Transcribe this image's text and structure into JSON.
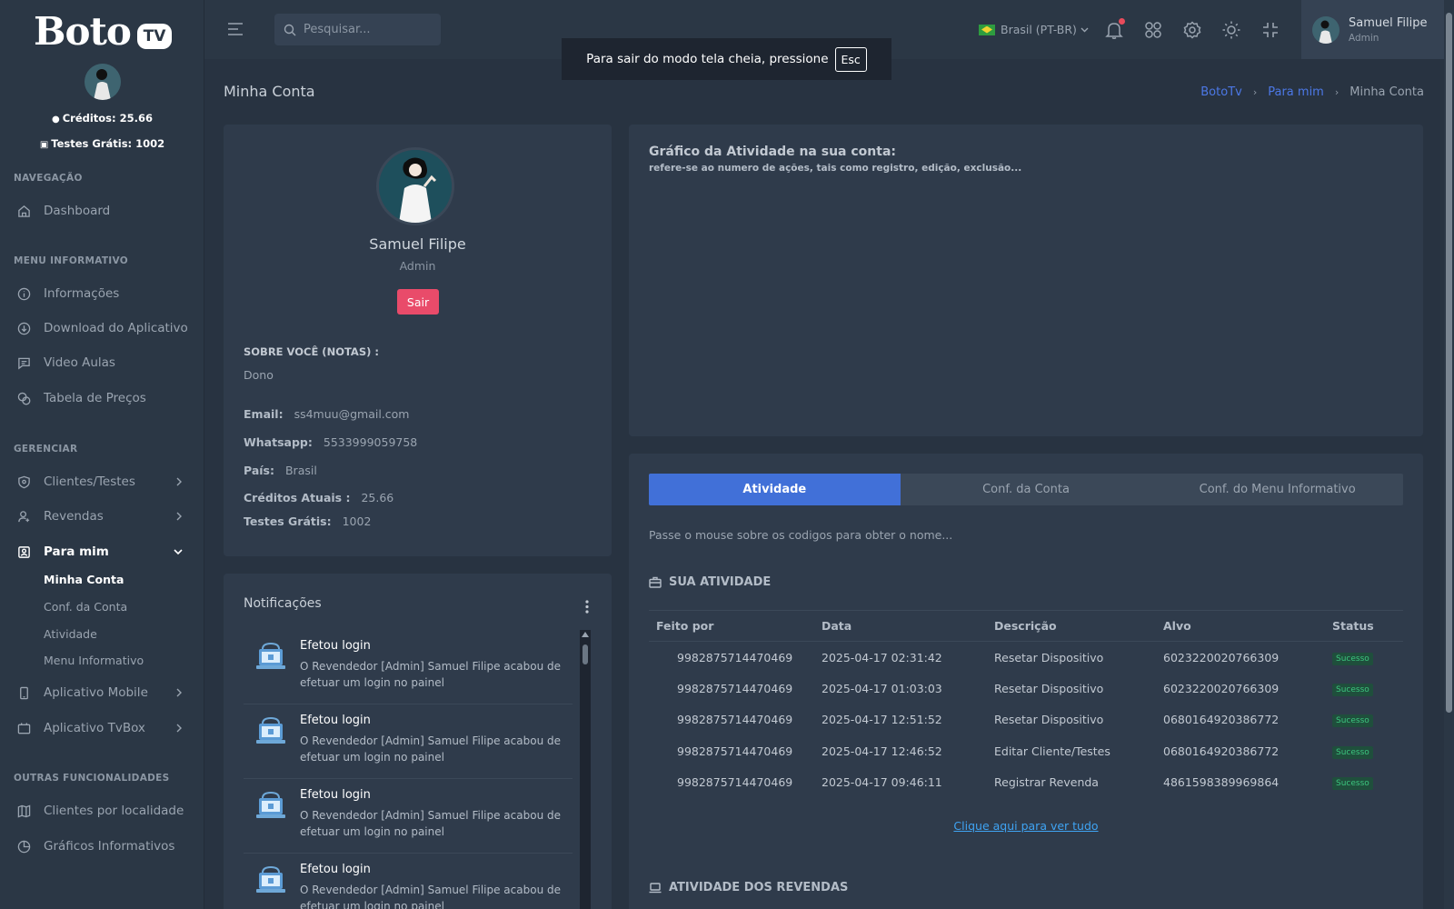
{
  "brand": {
    "name": "Boto",
    "badge": "TV"
  },
  "sidebar": {
    "credits": "Créditos: 25.66",
    "free_tests": "Testes Grátis: 1002",
    "headers": [
      "NAVEGAÇÃO",
      "MENU INFORMATIVO",
      "GERENCIAR",
      "OUTRAS FUNCIONALIDADES"
    ],
    "items": [
      {
        "label": "Dashboard",
        "icon": "home-icon"
      },
      {
        "label": "Informações",
        "icon": "info-icon"
      },
      {
        "label": "Download do Aplicativo",
        "icon": "download-icon"
      },
      {
        "label": "Video Aulas",
        "icon": "chat-icon"
      },
      {
        "label": "Tabela de Preços",
        "icon": "coins-icon"
      },
      {
        "label": "Clientes/Testes",
        "icon": "shield-icon"
      },
      {
        "label": "Revendas",
        "icon": "user-icon"
      },
      {
        "label": "Para mim",
        "icon": "user-square-icon"
      },
      {
        "label": "Aplicativo Mobile",
        "icon": "mobile-icon"
      },
      {
        "label": "Aplicativo TvBox",
        "icon": "tv-icon"
      },
      {
        "label": "Clientes por localidade",
        "icon": "map-icon"
      },
      {
        "label": "Gráficos Informativos",
        "icon": "pie-chart-icon"
      }
    ],
    "sub_items": [
      "Minha Conta",
      "Conf. da Conta",
      "Atividade",
      "Menu Informativo"
    ]
  },
  "topbar": {
    "search_placeholder": "Pesquisar...",
    "language": "Brasil (PT-BR)",
    "user_name": "Samuel Filipe",
    "user_role": "Admin"
  },
  "toast": {
    "text": "Para sair do modo tela cheia, pressione",
    "key": "Esc"
  },
  "page": {
    "title": "Minha Conta",
    "breadcrumbs": [
      "BotoTv",
      "Para mim",
      "Minha Conta"
    ]
  },
  "profile": {
    "name": "Samuel Filipe",
    "role": "Admin",
    "logout_label": "Sair",
    "about_label": "SOBRE VOCÊ (NOTAS) :",
    "about_text": "Dono",
    "fields": [
      {
        "k": "Email:",
        "v": "ss4muu@gmail.com"
      },
      {
        "k": "Whatsapp:",
        "v": "5533999059758"
      },
      {
        "k": "País:",
        "v": "Brasil"
      },
      {
        "k": "Créditos Atuais :",
        "v": "25.66"
      },
      {
        "k": "Testes Grátis:",
        "v": "1002"
      }
    ]
  },
  "notifications": {
    "title": "Notificações",
    "items": [
      {
        "title": "Efetou login",
        "desc": "O Revendedor [Admin] Samuel Filipe acabou de efetuar um login no painel"
      },
      {
        "title": "Efetou login",
        "desc": "O Revendedor [Admin] Samuel Filipe acabou de efetuar um login no painel"
      },
      {
        "title": "Efetou login",
        "desc": "O Revendedor [Admin] Samuel Filipe acabou de efetuar um login no painel"
      },
      {
        "title": "Efetou login",
        "desc": "O Revendedor [Admin] Samuel Filipe acabou de efetuar um login no painel"
      }
    ]
  },
  "chart": {
    "title": "Gráfico da Atividade na sua conta:",
    "subtitle": "refere-se ao numero de ações, tais como registro, edição, exclusão..."
  },
  "activity": {
    "tabs": [
      "Atividade",
      "Conf. da Conta",
      "Conf. do Menu Informativo"
    ],
    "hint": "Passe o mouse sobre os codigos para obter o nome...",
    "section_title": "SUA ATIVIDADE",
    "columns": [
      "Feito por",
      "Data",
      "Descrição",
      "Alvo",
      "Status"
    ],
    "rows": [
      [
        "9982875714470469",
        "2025-04-17 02:31:42",
        "Resetar Dispositivo",
        "6023220020766309",
        "Sucesso"
      ],
      [
        "9982875714470469",
        "2025-04-17 01:03:03",
        "Resetar Dispositivo",
        "6023220020766309",
        "Sucesso"
      ],
      [
        "9982875714470469",
        "2025-04-17 12:51:52",
        "Resetar Dispositivo",
        "0680164920386772",
        "Sucesso"
      ],
      [
        "9982875714470469",
        "2025-04-17 12:46:52",
        "Editar Cliente/Testes",
        "0680164920386772",
        "Sucesso"
      ],
      [
        "9982875714470469",
        "2025-04-17 09:46:11",
        "Registrar Revenda",
        "4861598389969864",
        "Sucesso"
      ]
    ],
    "see_all": "Clique aqui para ver tudo",
    "resellers_title": "ATIVIDADE DOS REVENDAS"
  },
  "colors": {
    "accent": "#4170d8",
    "danger": "#e94b6a",
    "success": "#3cc57e",
    "link": "#3fa3f2"
  }
}
